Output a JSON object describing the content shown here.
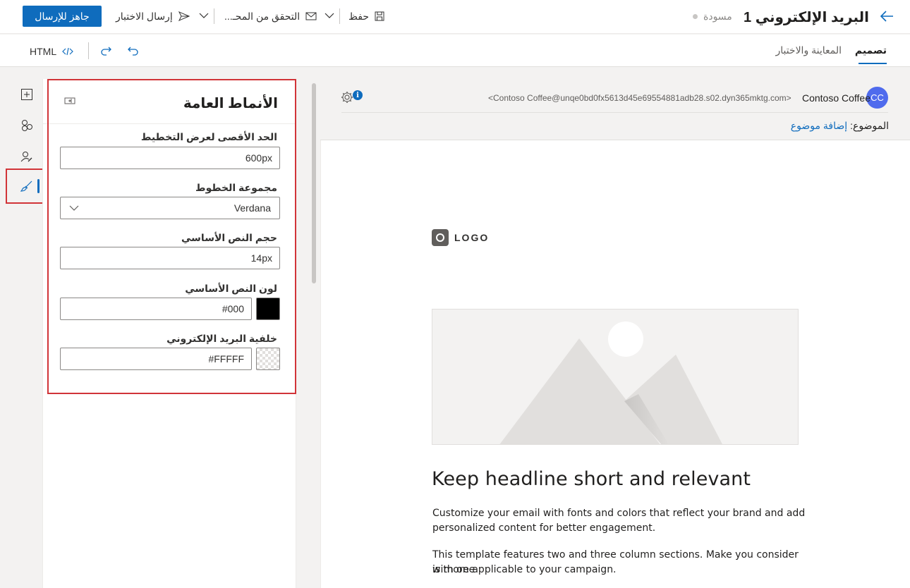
{
  "header": {
    "title": "البريد الإلكتروني 1",
    "status": "مسودة",
    "ready_button": "جاهز للإرسال",
    "send_test": "إرسال الاختبار",
    "check": "التحقق من المحـ...",
    "save": "حفظ"
  },
  "tabs": {
    "design": "تصميم",
    "preview": "المعاينة والاختبار"
  },
  "toolbar": {
    "html_label": "HTML"
  },
  "rail": {
    "items": [
      "add-element",
      "elements",
      "personalization",
      "styles"
    ]
  },
  "panel": {
    "title": "الأنماط العامة",
    "fields": {
      "max_width_label": "الحد الأقصى لعرض التخطيط",
      "max_width_value": "600px",
      "font_family_label": "مجموعة الخطوط",
      "font_family_value": "Verdana",
      "base_size_label": "حجم النص الأساسي",
      "base_size_value": "14px",
      "text_color_label": "لون النص الأساسي",
      "text_color_value": "#000",
      "bg_label": "خلفية البريد الإلكتروني",
      "bg_value": "#FFFFF"
    }
  },
  "email": {
    "avatar_initials": "CC",
    "sender_name": "Contoso Coffee",
    "sender_address": "<Contoso Coffee@unqe0bd0fx5613d45e69554881adb28.s02.dyn365mktg.com>",
    "subject_label": "الموضوع:",
    "subject_placeholder": "إضافة موضوع",
    "logo_text": "LOGO",
    "headline": "Keep headline short and relevant",
    "para1_line1": "Customize your email with fonts and colors that reflect your brand and add",
    "para1_line2": "personalized content for better engagement.",
    "para2_line1": "This template features two and three column sections. Make you consider with one",
    "para2_line2": "is more applicable to your campaign."
  },
  "colors": {
    "accent": "#0f6cbd",
    "highlight": "#d13438",
    "avatar": "#4f6bed",
    "text_color_swatch": "#000000"
  }
}
